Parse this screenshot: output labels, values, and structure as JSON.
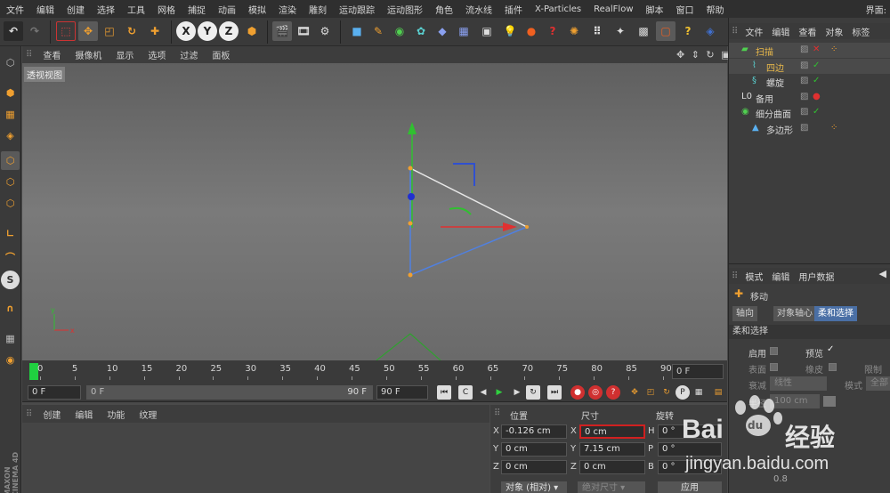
{
  "menubar": {
    "items": [
      "文件",
      "编辑",
      "创建",
      "选择",
      "工具",
      "网格",
      "捕捉",
      "动画",
      "模拟",
      "渲染",
      "雕刻",
      "运动跟踪",
      "运动图形",
      "角色",
      "流水线",
      "插件",
      "X-Particles",
      "RealFlow",
      "脚本",
      "窗口",
      "帮助"
    ],
    "layout_label": "界面:"
  },
  "toolbar": {
    "undo_icon": "undo-icon",
    "axis_x": "X",
    "axis_y": "Y",
    "axis_z": "Z"
  },
  "viewport": {
    "menu": [
      "查看",
      "摄像机",
      "显示",
      "选项",
      "过滤",
      "面板"
    ],
    "label": "透视视图"
  },
  "timeline": {
    "ticks": [
      "0",
      "5",
      "10",
      "15",
      "20",
      "25",
      "30",
      "35",
      "40",
      "45",
      "50",
      "55",
      "60",
      "65",
      "70",
      "75",
      "80",
      "85",
      "90"
    ],
    "current_frame": "0 F"
  },
  "transport": {
    "start_frame": "0 F",
    "slider_start": "0 F",
    "slider_end": "90 F",
    "end_frame": "90 F"
  },
  "material": {
    "menu": [
      "创建",
      "编辑",
      "功能",
      "纹理"
    ]
  },
  "coords": {
    "headers": {
      "position": "位置",
      "size": "尺寸",
      "rotation": "旋转"
    },
    "rows": [
      {
        "axis": "X",
        "pos": "-0.126 cm",
        "size_axis": "X",
        "size": "0 cm",
        "rot_axis": "H",
        "rot": "0 °"
      },
      {
        "axis": "Y",
        "pos": "0 cm",
        "size_axis": "Y",
        "size": "7.15 cm",
        "rot_axis": "P",
        "rot": "0 °"
      },
      {
        "axis": "Z",
        "pos": "0 cm",
        "size_axis": "Z",
        "size": "0 cm",
        "rot_axis": "B",
        "rot": "0 °"
      }
    ],
    "mode_select": "对象 (相对)",
    "size_select": "绝对尺寸",
    "apply": "应用"
  },
  "objects": {
    "menu": [
      "文件",
      "编辑",
      "查看",
      "对象",
      "标签"
    ],
    "items": [
      {
        "name": "扫描",
        "color": "#e8b84a"
      },
      {
        "name": "四边",
        "color": "#e8b84a"
      },
      {
        "name": "螺旋",
        "color": "#d6d6d6"
      },
      {
        "name": "备用",
        "color": "#d6d6d6"
      },
      {
        "name": "细分曲面",
        "color": "#d6d6d6"
      },
      {
        "name": "多边形",
        "color": "#d6d6d6"
      }
    ]
  },
  "attributes": {
    "menu": [
      "模式",
      "编辑",
      "用户数据"
    ],
    "tool_name": "移动",
    "tabs": [
      "轴向",
      "对象轴心",
      "柔和选择"
    ],
    "section": "柔和选择",
    "labels": {
      "enable": "启用",
      "preview": "预览",
      "surface": "表面",
      "rubber": "橡皮",
      "limit": "限制",
      "falloff": "衰减",
      "falloff_value": "线性",
      "mode": "模式",
      "mode_value": "全部",
      "radius": "半径",
      "radius_value": "100 cm",
      "value_08": "0.8"
    }
  },
  "watermark": {
    "brand": "Bai",
    "brand_suffix": "经验",
    "url": "jingyan.baidu.com"
  },
  "maxon": {
    "line1": "MAXON",
    "line2": "CINEMA 4D"
  },
  "colors": {
    "accent_orange": "#f0a030",
    "axis_x": "#e03030",
    "axis_y": "#30c030",
    "axis_z": "#3060e0",
    "highlight_red": "#d02020",
    "tab_active": "#4a6fa5"
  }
}
